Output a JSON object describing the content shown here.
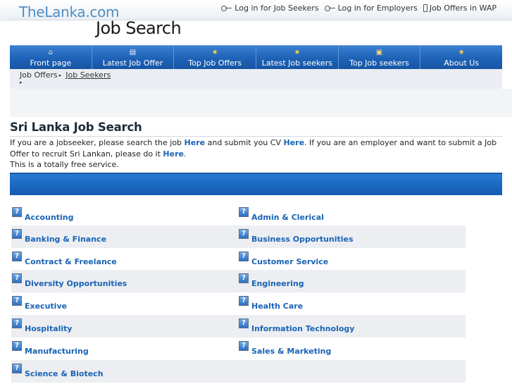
{
  "header": {
    "logo": "TheLanka.com",
    "site_title": "Job Search",
    "links": [
      {
        "label": "Log in for Job Seekers",
        "icon": "key-icon"
      },
      {
        "label": "Log in for Employers",
        "icon": "key-icon"
      },
      {
        "label": "Job Offers in WAP",
        "icon": "phone-icon"
      }
    ]
  },
  "nav": {
    "items": [
      {
        "label": "Front page",
        "icon": "house-icon"
      },
      {
        "label": "Latest Job Offer",
        "icon": "document-icon"
      },
      {
        "label": "Top Job Offers",
        "icon": "star-icon"
      },
      {
        "label": "Latest Job seekers",
        "icon": "star-icon"
      },
      {
        "label": "Top Job seekers",
        "icon": "folder-icon"
      },
      {
        "label": "About Us",
        "icon": "star-icon"
      }
    ]
  },
  "breadcrumb": {
    "first": "Job Offers",
    "second": "Job Seekers"
  },
  "main": {
    "title": "Sri Lanka Job Search",
    "intro": {
      "part1": "If you are a jobseeker, please search the job ",
      "link1": "Here",
      "part2": " and submit you CV ",
      "link2": "Here",
      "part3": ". If you are an employer and want to submit a Job Offer to recruit Sri Lankan, please do it ",
      "link3": "Here",
      "part4": ".",
      "line2": "This is a totally free service."
    }
  },
  "categories": [
    "Accounting",
    "Admin & Clerical",
    "Banking & Finance",
    "Business Opportunities",
    "Contract & Freelance",
    "Customer Service",
    "Diversity Opportunities",
    "Engineering",
    "Executive",
    "Health Care",
    "Hospitality",
    "Information Technology",
    "Manufacturing",
    "Sales & Marketing",
    "Science & Biotech"
  ],
  "colors": {
    "nav_blue": "#1d62b6",
    "link_blue": "#1a63b5",
    "logo_blue": "#4f8fc6"
  }
}
